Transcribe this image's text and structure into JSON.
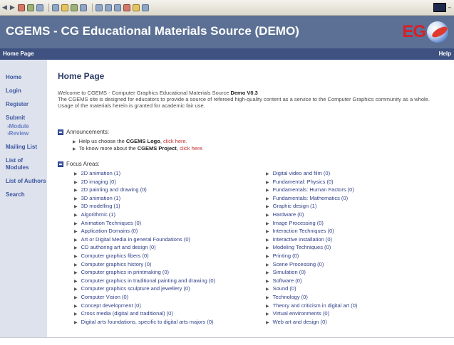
{
  "site": {
    "title": "CGEMS - CG Educational Materials Source (DEMO)",
    "brand": "EG"
  },
  "navbar": {
    "home": "Home Page",
    "help": "Help"
  },
  "sidebar": {
    "items": [
      "Home",
      "Login",
      "Register"
    ],
    "submit": {
      "label": "Submit",
      "sub": [
        "›Module",
        "›Review"
      ]
    },
    "items2": [
      "Mailing List",
      "List of Modules",
      "List of Authors",
      "Search"
    ]
  },
  "main": {
    "title": "Home Page",
    "intro_prefix": "Welcome to CGEMS - Computer Graphics Educational Materials Source ",
    "intro_bold": "Demo V0.3",
    "intro_rest": "The CGEMS site is designed for educators to provide a source of refereed high-quality content as a service to the Computer Graphics community as a whole. Usage of the materials herein is granted for academic fair use.",
    "announcements": {
      "heading": "Announcements:",
      "items": [
        {
          "prefix": "Help us choose the ",
          "bold": "CGEMS Logo",
          "mid": ", ",
          "link": "click here."
        },
        {
          "prefix": "To know more about the ",
          "bold": "CGEMS Project",
          "mid": ", ",
          "link": "click here."
        }
      ]
    },
    "focus": {
      "heading": "Focus Areas:",
      "left": [
        "2D animation (1)",
        "2D imaging (0)",
        "2D painting and drawing (0)",
        "3D animation (1)",
        "3D modelling (1)",
        "Algorithmic (1)",
        "Animation Techniques (0)",
        "Application Domains (0)",
        "Art or Digital Media in general Foundations (0)",
        "CD authoring art and design (0)",
        "Computer graphics fibers (0)",
        "Computer graphics history (0)",
        "Computer graphics in printmaking (0)",
        "Computer graphics in traditional painting and drawing (0)",
        "Computer graphics sculpture and jewellery (0)",
        "Computer Vision (0)",
        "Concept development (0)",
        "Cross media (digital and traditional) (0)",
        "Digital arts foundations, specific to digital arts majors (0)"
      ],
      "right": [
        "Digital video and film (0)",
        "Fundamental: Physics (0)",
        "Fundamentals: Human Factors (0)",
        "Fundamentals: Mathematics (0)",
        "Graphic design (1)",
        "Hardware (0)",
        "Image Processing (0)",
        "Interaction Techniques (0)",
        "Interactive installation (0)",
        "Modeling Techniques (0)",
        "Printing (0)",
        "Scene Processing (0)",
        "Simulation (0)",
        "Software (0)",
        "Sound (0)",
        "Technology (0)",
        "Theory and criticism in digital art (0)",
        "Virtual environments (0)",
        "Web art and design (0)"
      ]
    }
  },
  "colors": {
    "header_bg": "#5b7094",
    "navbar_bg": "#3e5180",
    "sidebar_bg": "#dde2ec",
    "link": "#2f3f86",
    "brand_red": "#d71f26"
  }
}
